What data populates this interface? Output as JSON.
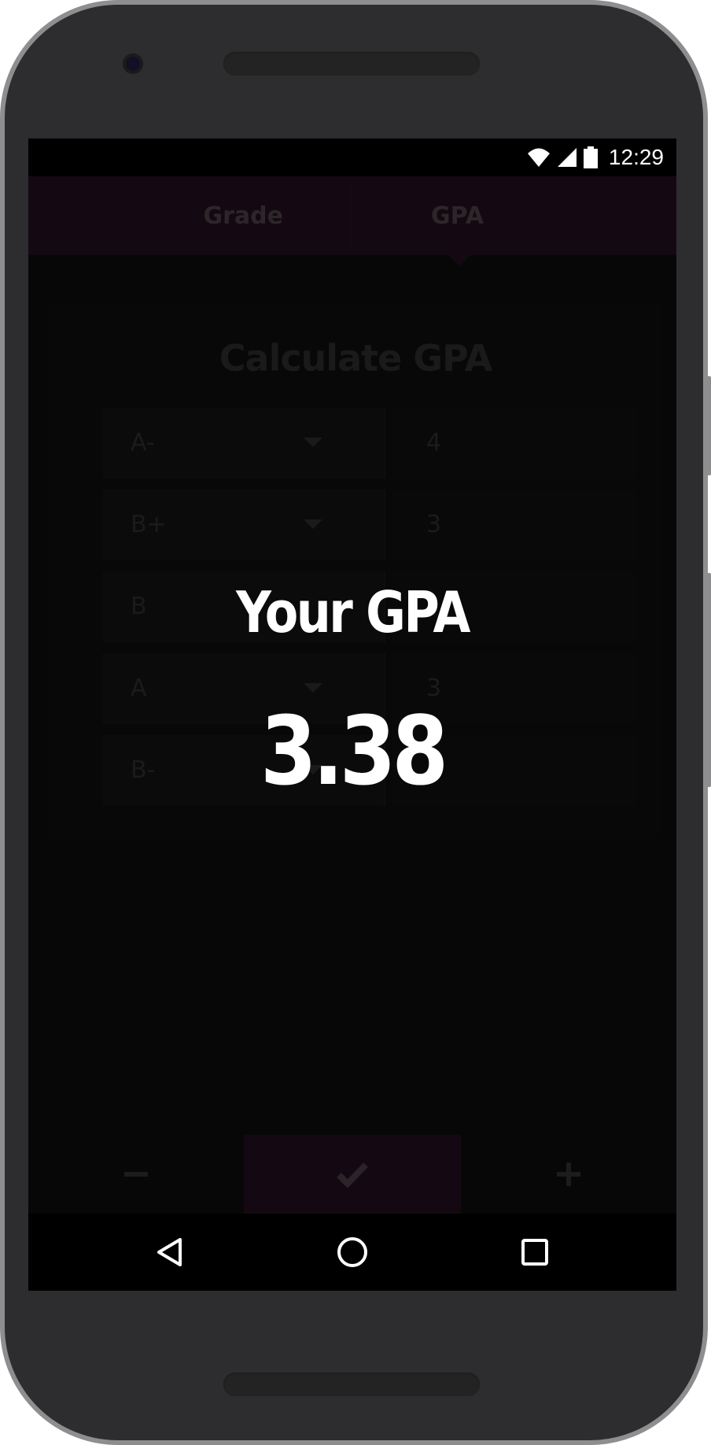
{
  "status_bar": {
    "time": "12:29",
    "icons": [
      "wifi-icon",
      "signal-icon",
      "battery-icon"
    ]
  },
  "tabs": [
    {
      "label": "Grade",
      "selected": false
    },
    {
      "label": "GPA",
      "selected": true
    }
  ],
  "card": {
    "title": "Calculate GPA",
    "rows": [
      {
        "grade": "A-",
        "credits": "4"
      },
      {
        "grade": "B+",
        "credits": "3"
      },
      {
        "grade": "B",
        "credits": ""
      },
      {
        "grade": "A",
        "credits": "3"
      },
      {
        "grade": "B-",
        "credits": ""
      }
    ]
  },
  "result_overlay": {
    "title": "Your GPA",
    "value": "3.38"
  },
  "actions": {
    "remove_icon": "minus-icon",
    "calculate_icon": "check-icon",
    "add_icon": "plus-icon"
  },
  "nav": {
    "icons": [
      "back-icon",
      "home-icon",
      "recents-icon"
    ]
  },
  "colors": {
    "accent_dark": "#140912",
    "screen_bg": "#070707",
    "phone_body": "#2d2c2f",
    "overlay_text": "#ffffff"
  }
}
